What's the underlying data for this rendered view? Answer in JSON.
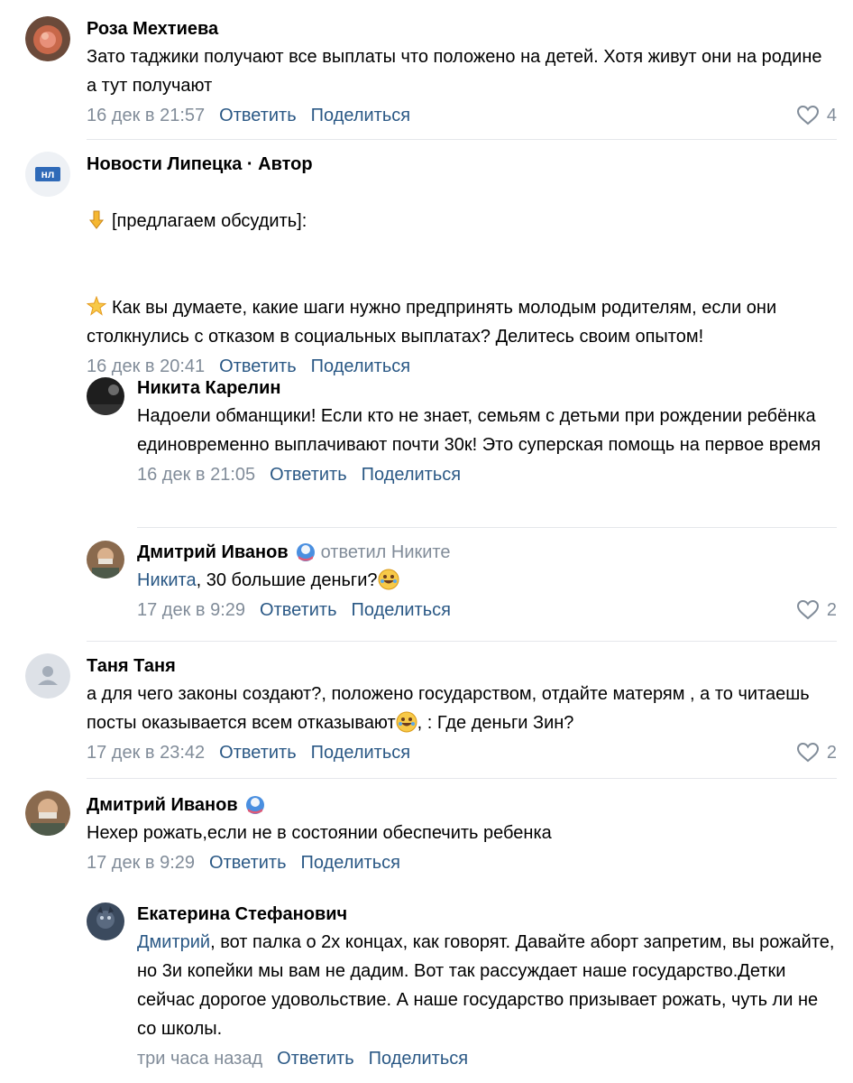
{
  "comments": [
    {
      "author": "Роза Мехтиева",
      "text": "Зато таджики получают все выплаты что положено на детей. Хотя живут они на родине а тут получают",
      "date": "16 дек в 21:57",
      "reply": "Ответить",
      "share": "Поделиться",
      "likes": "4"
    },
    {
      "author": "Новости Липецка · Автор",
      "avatar_text": "нл",
      "line1": "[предлагаем обсудить]:",
      "line2": "Как вы думаете, какие шаги нужно предпринять молодым родителям, если они столкнулись с отказом в социальных выплатах? Делитесь своим опытом!",
      "date": "16 дек в 20:41",
      "reply": "Ответить",
      "share": "Поделиться"
    },
    {
      "author": "Никита Карелин",
      "text": "Надоели обманщики! Если кто не знает, семьям с детьми при рождении ребёнка единовременно выплачивают почти 30к! Это суперская помощь на первое время",
      "date": "16 дек в 21:05",
      "reply": "Ответить",
      "share": "Поделиться"
    },
    {
      "author": "Дмитрий Иванов",
      "replied_to": "ответил Никите",
      "mention": "Никита",
      "text": ", 30 большие деньги?",
      "date": "17 дек в 9:29",
      "reply": "Ответить",
      "share": "Поделиться",
      "likes": "2"
    },
    {
      "author": "Таня Таня",
      "text_a": "а для чего законы создают?, положено государством, отдайте матерям , а то читаешь посты оказывается всем отказывают",
      "text_b": ", : Где деньги Зин?",
      "date": "17 дек в 23:42",
      "reply": "Ответить",
      "share": "Поделиться",
      "likes": "2"
    },
    {
      "author": "Дмитрий Иванов",
      "text": "Нехер рожать,если не в состоянии обеспечить ребенка",
      "date": "17 дек в 9:29",
      "reply": "Ответить",
      "share": "Поделиться"
    },
    {
      "author": "Екатерина Стефанович",
      "mention": "Дмитрий",
      "text": ", вот палка о 2х концах, как говорят. Давайте аборт запретим, вы рожайте, но 3и копейки мы вам не дадим. Вот так рассуждает наше государство.Детки сейчас дорогое удовольствие. А наше государство призывает рожать, чуть ли не со школы.",
      "date": "три часа назад",
      "reply": "Ответить",
      "share": "Поделиться"
    }
  ],
  "colors": {
    "link": "#2a5885",
    "secondary": "#818c99",
    "separator": "#e5e7eb"
  },
  "icons": [
    "heart-icon",
    "pointing-down-emoji",
    "star-emoji",
    "rofl-emoji",
    "donut-badge-icon"
  ]
}
